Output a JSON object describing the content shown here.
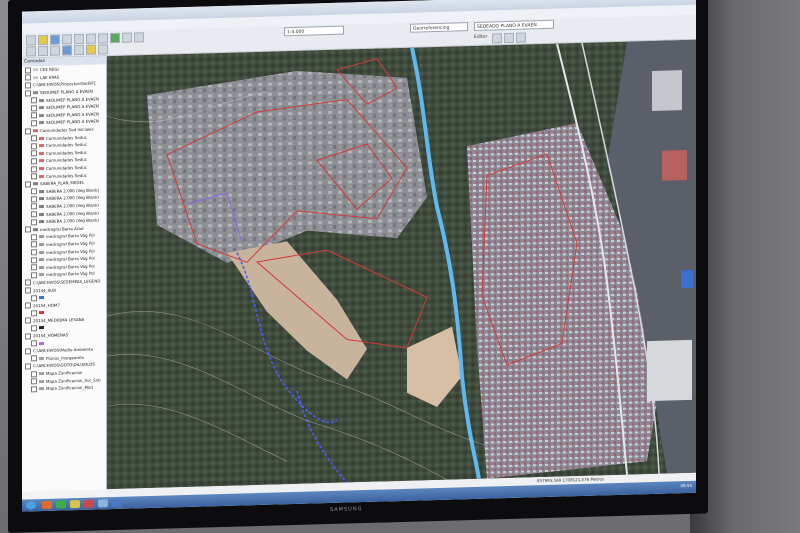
{
  "toolbar": {
    "layer_dropdown": "Georreferencing",
    "map_dropdown": "SEDEADO PLANO A EVAEN",
    "scale_dropdown": "1:4.000",
    "editor_label": "Editor"
  },
  "toc": {
    "title": "Camadas",
    "items": [
      {
        "label": "CEE REGI",
        "color": "#c8c8c8",
        "indent": false
      },
      {
        "label": "LAE ERAS",
        "color": "#c8c8c8",
        "indent": false
      },
      {
        "label": "C:\\ARCHIVOS\\Proyectos\\Sed\\IFC",
        "color": "",
        "indent": false
      },
      {
        "label": "SEDUMEP PLANO A EVAEN",
        "color": "#8a8a8a",
        "indent": false
      },
      {
        "label": "SEDUMEP PLANO A EVAEN",
        "color": "#8a8a8a",
        "indent": true
      },
      {
        "label": "SEDUMEP PLANO A EVAEN",
        "color": "#8a8a8a",
        "indent": true
      },
      {
        "label": "SEDUMEP PLANO A EVAEN",
        "color": "#8a8a8a",
        "indent": true
      },
      {
        "label": "SEDUMEP PLANO A EVAEN",
        "color": "#8a8a8a",
        "indent": true
      },
      {
        "label": "Comunidades Sed Iniciales",
        "color": "#d46a6a",
        "indent": false
      },
      {
        "label": "Comunidades Seduc",
        "color": "#d46a6a",
        "indent": true
      },
      {
        "label": "Comunidades Seduc",
        "color": "#d46a6a",
        "indent": true
      },
      {
        "label": "Comunidades Seduc",
        "color": "#d46a6a",
        "indent": true
      },
      {
        "label": "Comunidades Seduc",
        "color": "#d46a6a",
        "indent": true
      },
      {
        "label": "Comunidades Seduc",
        "color": "#d46a6a",
        "indent": true
      },
      {
        "label": "Comunidades Seduc",
        "color": "#d46a6a",
        "indent": true
      },
      {
        "label": "SABERA_PLAN_MEDEL",
        "color": "#7d7d7d",
        "indent": false
      },
      {
        "label": "SABERA 2.000 (Veg Blank)",
        "color": "#7d7d7d",
        "indent": true
      },
      {
        "label": "SABERA 2.000 (Veg Blank)",
        "color": "#7d7d7d",
        "indent": true
      },
      {
        "label": "SABERA 2.000 (Veg Blank)",
        "color": "#7d7d7d",
        "indent": true
      },
      {
        "label": "SABERA 2.000 (Veg Blank)",
        "color": "#7d7d7d",
        "indent": true
      },
      {
        "label": "SABERA 2.000 (Veg Blank)",
        "color": "#7d7d7d",
        "indent": true
      },
      {
        "label": "medragral Barra Arad",
        "color": "#7d7d7d",
        "indent": false
      },
      {
        "label": "medragral Barra Vag Pol",
        "color": "#9a9a9a",
        "indent": true
      },
      {
        "label": "medragral Barra Vag Pol",
        "color": "#9a9a9a",
        "indent": true
      },
      {
        "label": "medragral Barra Vag Pol",
        "color": "#9a9a9a",
        "indent": true
      },
      {
        "label": "medragral Barra Vag Pol",
        "color": "#9a9a9a",
        "indent": true
      },
      {
        "label": "medragral Barra Vag Pol",
        "color": "#9a9a9a",
        "indent": true
      },
      {
        "label": "medragral Barra Vag Pol",
        "color": "#9a9a9a",
        "indent": true
      },
      {
        "label": "C:\\ARCHIVOS\\SEDEMPAS_LEGEND",
        "color": "",
        "indent": false
      },
      {
        "label": "20144_SUR",
        "color": "",
        "indent": false
      },
      {
        "label": "",
        "color": "#3b6fd1",
        "indent": true
      },
      {
        "label": "20154_HOM7",
        "color": "",
        "indent": false
      },
      {
        "label": "",
        "color": "#d43838",
        "indent": true
      },
      {
        "label": "20154_MEDIOMA LESANA",
        "color": "",
        "indent": false
      },
      {
        "label": "",
        "color": "#222222",
        "indent": true
      },
      {
        "label": "20154_HOMENAS",
        "color": "",
        "indent": false
      },
      {
        "label": "",
        "color": "#b86ad6",
        "indent": true
      },
      {
        "label": "C:\\ARCHIVOS\\Medio Ambiente",
        "color": "",
        "indent": false
      },
      {
        "label": "Planos_mergeamla",
        "color": "#a0a0a0",
        "indent": true
      },
      {
        "label": "C:\\ARCHIVOS\\GOTO\\DIL\\SOLOS",
        "color": "",
        "indent": false
      },
      {
        "label": "Mapa Zonificacion",
        "color": "#a0a0a0",
        "indent": true
      },
      {
        "label": "Mapa Zonificacion_Sur_Sub",
        "color": "#a0a0a0",
        "indent": true
      },
      {
        "label": "Mapa Zonificacion_Mod",
        "color": "#a0a0a0",
        "indent": true
      }
    ]
  },
  "status": {
    "coords": "837995,569  1708121,576 Metros",
    "clock": "09:55"
  },
  "monitor": {
    "brand": "SAMSUNG"
  },
  "colors": {
    "boundary_red": "#d23a3a",
    "river_blue": "#5fb8f0",
    "landslide_blue": "#4a5cff"
  }
}
